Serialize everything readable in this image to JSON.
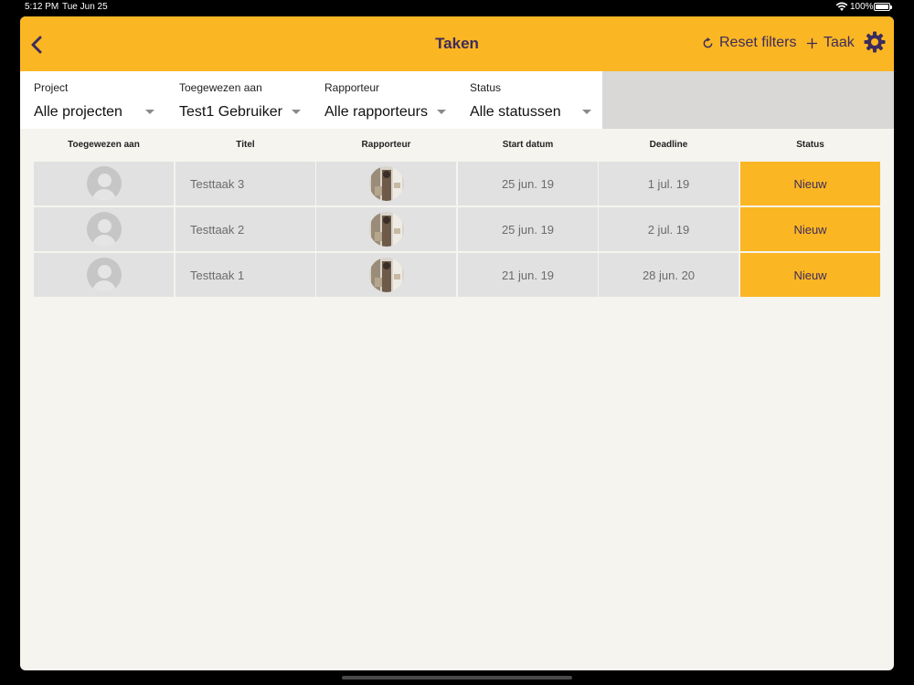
{
  "status_bar": {
    "time": "5:12 PM",
    "date": "Tue Jun 25",
    "battery": "100%",
    "battery_level": 1.0
  },
  "navbar": {
    "title": "Taken",
    "reset_label": "Reset filters",
    "add_label": "Taak",
    "icons": {
      "back": "chevron-left-icon",
      "reset": "refresh-icon",
      "add": "plus-icon",
      "settings": "gear-icon"
    },
    "colors": {
      "background": "#fbb623",
      "text": "#3c2c5c"
    }
  },
  "filters": [
    {
      "label": "Project",
      "value": "Alle projecten"
    },
    {
      "label": "Toegewezen aan",
      "value": "Test1 Gebruiker"
    },
    {
      "label": "Rapporteur",
      "value": "Alle rapporteurs"
    },
    {
      "label": "Status",
      "value": "Alle statussen"
    }
  ],
  "table": {
    "headers": [
      "Toegewezen aan",
      "Titel",
      "Rapporteur",
      "Start datum",
      "Deadline",
      "Status"
    ],
    "rows": [
      {
        "title": "Testtaak 3",
        "start": "25 jun. 19",
        "deadline": "1 jul. 19",
        "status": "Nieuw"
      },
      {
        "title": "Testtaak 2",
        "start": "25 jun. 19",
        "deadline": "2 jul. 19",
        "status": "Nieuw"
      },
      {
        "title": "Testtaak 1",
        "start": "21 jun. 19",
        "deadline": "28 jun. 20",
        "status": "Nieuw"
      }
    ],
    "colors": {
      "cell": "#e1e1e1",
      "status": "#fbb623"
    }
  }
}
